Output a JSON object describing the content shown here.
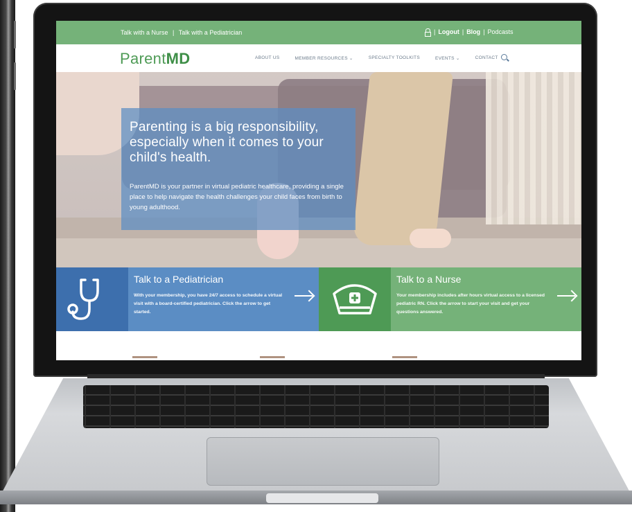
{
  "topbar": {
    "link_nurse": "Talk with a Nurse",
    "separator": "|",
    "link_pediatrician": "Talk with a Pediatrician",
    "logout": "Logout",
    "blog": "Blog",
    "podcasts": "Podcasts"
  },
  "nav": {
    "logo_parent": "Parent",
    "logo_md": "MD",
    "items": [
      {
        "label": "ABOUT US"
      },
      {
        "label": "MEMBER RESOURCES ⌄"
      },
      {
        "label": "SPECIALTY TOOLKITS"
      },
      {
        "label": "EVENTS ⌄"
      },
      {
        "label": "CONTACT"
      }
    ]
  },
  "hero": {
    "title": "Parenting is a big responsibility, especially when it comes to your child's health.",
    "text": "ParentMD is your partner in virtual pediatric healthcare, providing a single place to help navigate the health challenges your child faces from birth to young adulthood."
  },
  "cards": {
    "pediatrician": {
      "title": "Talk to a Pediatrician",
      "text": "With your membership, you have 24/7 access to schedule a virtual visit with a board-certified pediatrician. Click the arrow to get started."
    },
    "nurse": {
      "title": "Talk to a Nurse",
      "text": "Your membership includes after hours virtual access to a licensed pediatric RN. Click the arrow to start your visit and get your questions answered."
    }
  },
  "colors": {
    "green": "#75b279",
    "blue": "#5b8dc4",
    "dark_blue": "#3d6fad",
    "dark_green": "#4e9a55"
  },
  "icons": [
    "lock-icon",
    "search-icon",
    "stethoscope-icon",
    "nurse-cap-icon",
    "arrow-right-icon"
  ]
}
